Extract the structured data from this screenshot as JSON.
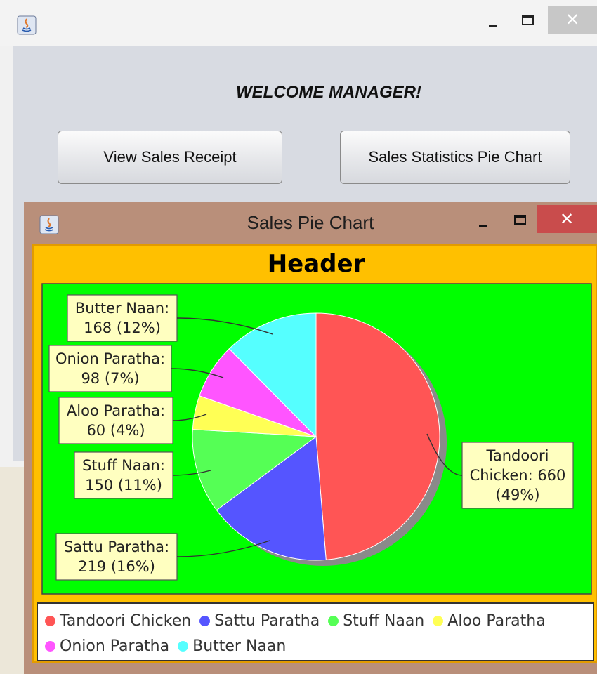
{
  "main_window": {
    "welcome_text": "WELCOME MANAGER!",
    "buttons": {
      "view_receipt": "View Sales Receipt",
      "pie_chart": "Sales Statistics Pie Chart"
    },
    "controls": {
      "minimize": "–",
      "maximize": "☐",
      "close": "✕"
    }
  },
  "pie_window": {
    "title": "Sales Pie Chart",
    "controls": {
      "minimize": "–",
      "maximize": "☐",
      "close": "✕"
    }
  },
  "colors": {
    "chart_panel_bg": "#ffc000",
    "plot_bg": "#00ff00",
    "label_box_bg": "#ffffc0",
    "close_button_active": "#c94c4c"
  },
  "chart_data": {
    "type": "pie",
    "title": "Header",
    "slices": [
      {
        "name": "Tandoori Chicken",
        "value": 660,
        "label_lines": [
          "Tandoori",
          "Chicken: 660",
          "(49%)"
        ],
        "color": "#ff5555"
      },
      {
        "name": "Sattu Paratha",
        "value": 219,
        "label_lines": [
          "Sattu Paratha:",
          "219 (16%)"
        ],
        "color": "#5555ff"
      },
      {
        "name": "Stuff Naan",
        "value": 150,
        "label_lines": [
          "Stuff Naan:",
          "150 (11%)"
        ],
        "color": "#55ff55"
      },
      {
        "name": "Aloo Paratha",
        "value": 60,
        "label_lines": [
          "Aloo Paratha:",
          "60 (4%)"
        ],
        "color": "#ffff55"
      },
      {
        "name": "Onion Paratha",
        "value": 98,
        "label_lines": [
          "Onion Paratha:",
          "98 (7%)"
        ],
        "color": "#ff55ff"
      },
      {
        "name": "Butter Naan",
        "value": 168,
        "label_lines": [
          "Butter Naan:",
          "168 (12%)"
        ],
        "color": "#55ffff"
      }
    ],
    "legend": [
      "Tandoori Chicken",
      "Sattu Paratha",
      "Stuff Naan",
      "Aloo Paratha",
      "Onion Paratha",
      "Butter Naan"
    ],
    "legend_position": "bottom"
  }
}
